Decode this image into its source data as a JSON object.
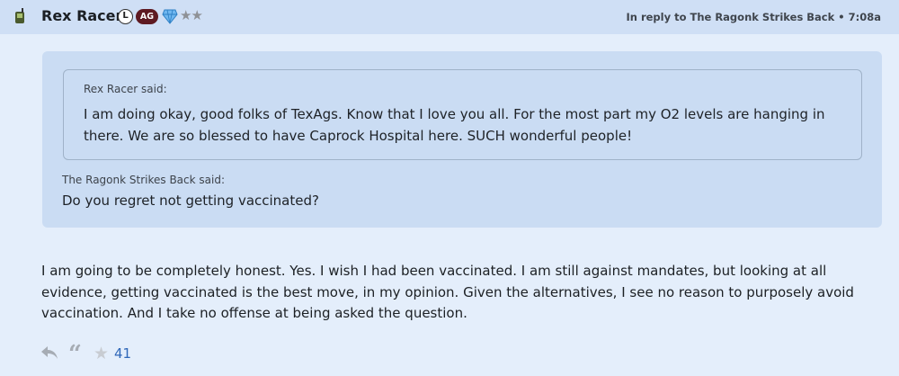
{
  "post": {
    "author": "Rex Racer",
    "badge_l": "L",
    "badge_ag": "AG",
    "stars": "★★",
    "reply_meta": "In reply to The Ragonk Strikes Back • 7:08a"
  },
  "quote": {
    "inner_author": "Rex Racer said:",
    "inner_text": "I am doing okay, good folks of TexAgs. Know that I love you all. For the most part my O2 levels are hanging in there. We are so blessed to have Caprock Hospital here. SUCH wonderful people!",
    "outer_author": "The Ragonk Strikes Back said:",
    "outer_text": "Do you regret not getting vaccinated?"
  },
  "body": "I am going to be completely honest. Yes. I wish I had been vaccinated. I am still against mandates, but looking at all evidence, getting vaccinated is the best move, in my opinion. Given the alternatives, I see no reason to purposely avoid vaccination. And I take no offense at being asked the question.",
  "actions": {
    "quote_glyph": "“",
    "star_glyph": "★",
    "like_count": "41"
  },
  "colors": {
    "background": "#e4eefb",
    "header": "#cfdff5",
    "quote_bg": "#cadcf3",
    "badge_ag": "#5e1a22",
    "link": "#2f67b8"
  },
  "icons": [
    "phone-icon",
    "diamond-icon",
    "reply-icon",
    "quote-icon",
    "star-icon"
  ]
}
